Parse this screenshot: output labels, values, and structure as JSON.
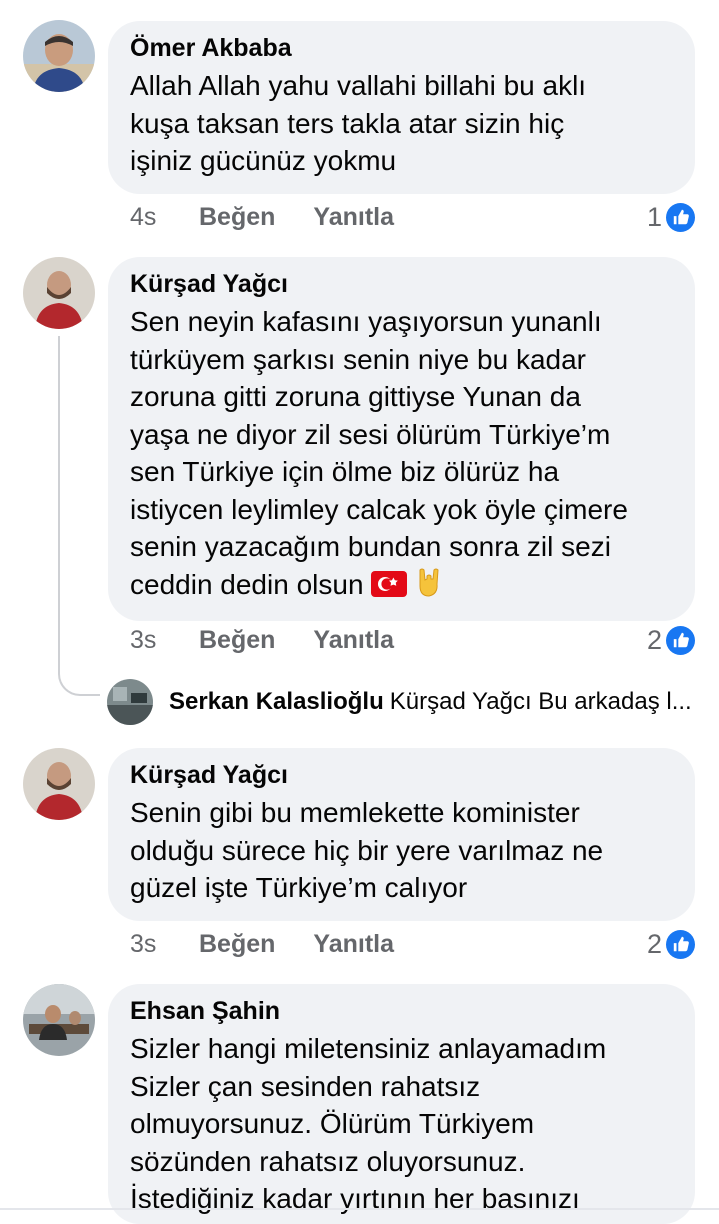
{
  "comments": [
    {
      "author": "Ömer Akbaba",
      "text": "Allah Allah yahu vallahi billahi bu aklı\nkuşa taksan  ters takla atar  sizin hiç\nişiniz gücünüz yokmu",
      "time": "4s",
      "like_label": "Beğen",
      "reply_label": "Yanıtla",
      "reactions": "1"
    },
    {
      "author": "Kürşad Yağcı",
      "text": "Sen neyin kafasını yaşıyorsun yunanlı\ntürküyem şarkısı senin niye bu kadar\nzoruna gitti zoruna gittiyse Yunan da\nyaşa ne diyor zil sesi ölürüm Türkiye’m\nsen Türkiye için ölme biz ölürüz ha\nistiycen  leylimley calcak yok öyle çimere\nsenin yazacağım bundan sonra zil sezi\nceddin dedin olsun",
      "time": "3s",
      "like_label": "Beğen",
      "reply_label": "Yanıtla",
      "reactions": "2",
      "emoji": [
        "turkish-flag-icon",
        "horns-hand-icon"
      ]
    },
    {
      "author": "Kürşad Yağcı",
      "text": "Senin gibi bu memlekette kominister\nolduğu sürece hiç bir yere varılmaz ne\ngüzel işte Türkiye’m calıyor",
      "time": "3s",
      "like_label": "Beğen",
      "reply_label": "Yanıtla",
      "reactions": "2"
    },
    {
      "author": "Ehsan Şahin",
      "text": "Sizler hangi miletensiniz anlayamadım\nSizler çan sesinden rahatsız\nolmuyorsunuz. Ölürüm Türkiyem\nsözünden rahatsız oluyorsunuz.\nİstediğiniz kadar yırtının her basınızı"
    }
  ],
  "reply_preview": {
    "author": "Serkan Kalaslioğlu",
    "text": "Kürşad Yağcı Bu arkadaş l..."
  },
  "colors": {
    "bubble": "#f0f2f5",
    "meta": "#65676b",
    "like_blue": "#1877f2",
    "thread_line": "#ced0d4"
  }
}
